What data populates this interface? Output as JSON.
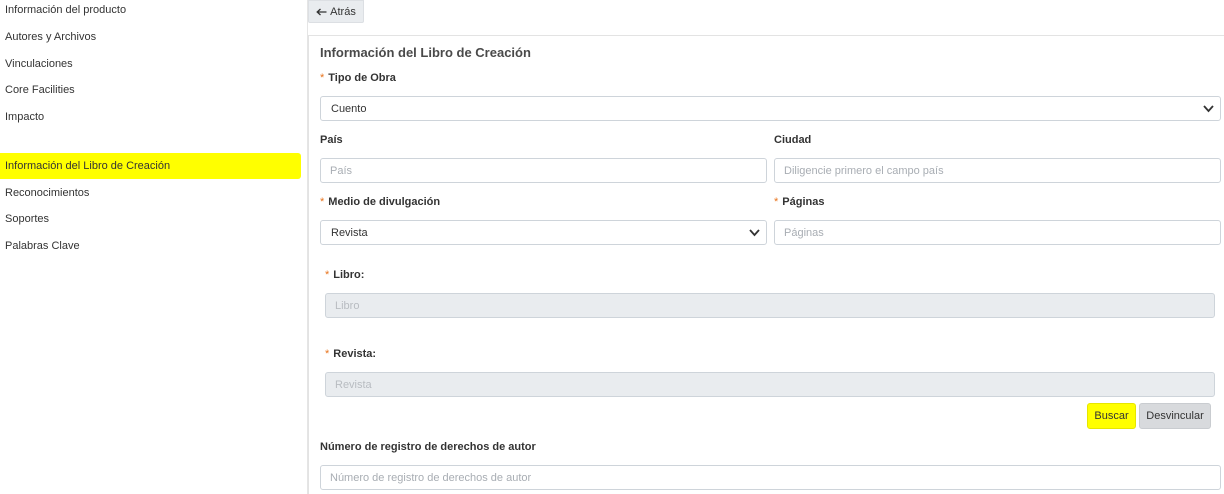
{
  "sidebar": {
    "items": [
      {
        "label": "Información del producto"
      },
      {
        "label": "Autores y Archivos"
      },
      {
        "label": "Vinculaciones"
      },
      {
        "label": "Core Facilities"
      },
      {
        "label": "Impacto"
      },
      {
        "label": "Información del Libro de Creación",
        "active": true
      },
      {
        "label": "Reconocimientos"
      },
      {
        "label": "Soportes"
      },
      {
        "label": "Palabras Clave"
      }
    ]
  },
  "toolbar": {
    "back_label": "Atrás",
    "back_icon": "arrow-left-icon"
  },
  "form": {
    "title": "Información del Libro de Creación",
    "required_mark": "*",
    "tipo_obra": {
      "label": "Tipo de Obra",
      "value": "Cuento"
    },
    "pais": {
      "label": "País",
      "placeholder": "País"
    },
    "ciudad": {
      "label": "Ciudad",
      "placeholder": "Diligencie primero el campo país"
    },
    "medio": {
      "label": "Medio de divulgación",
      "value": "Revista"
    },
    "paginas": {
      "label": "Páginas",
      "placeholder": "Páginas"
    },
    "libro": {
      "label": "Libro:",
      "placeholder": "Libro"
    },
    "revista": {
      "label": "Revista:",
      "placeholder": "Revista"
    },
    "registro": {
      "label": "Número de registro de derechos de autor",
      "placeholder": "Número de registro de derechos de autor"
    }
  },
  "actions": {
    "buscar_label": "Buscar",
    "desvincular_label": "Desvincular"
  },
  "colors": {
    "highlight": "#ffff00",
    "required": "#e8731c",
    "disabled_bg": "#e9ecef"
  }
}
